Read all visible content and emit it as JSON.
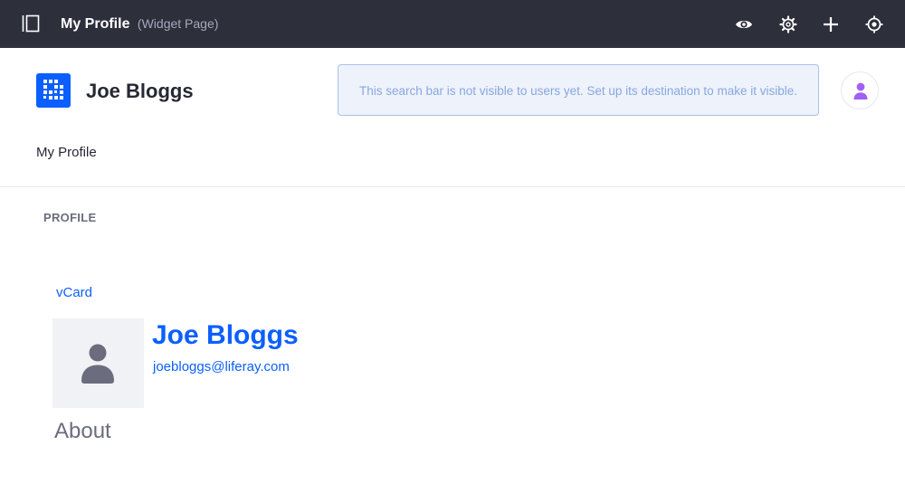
{
  "topbar": {
    "title": "My Profile",
    "subtitle": "(Widget Page)",
    "icons": [
      "product-menu-toggle-icon",
      "eye-icon",
      "gear-icon",
      "plus-icon",
      "simulation-icon"
    ]
  },
  "header": {
    "site_name": "Joe Bloggs",
    "search_notice": "This search bar is not visible to users yet. Set up its destination to make it visible."
  },
  "nav": {
    "items": [
      {
        "label": "My Profile"
      }
    ]
  },
  "profile": {
    "section_title": "PROFILE",
    "vcard_label": "vCard",
    "name": "Joe Bloggs",
    "email": "joebloggs@liferay.com",
    "about_heading": "About"
  },
  "colors": {
    "topbar_bg": "#2d2f3b",
    "accent": "#0b5fff",
    "avatar_purple": "#a25ff5",
    "portrait_bg": "#f1f2f5"
  }
}
